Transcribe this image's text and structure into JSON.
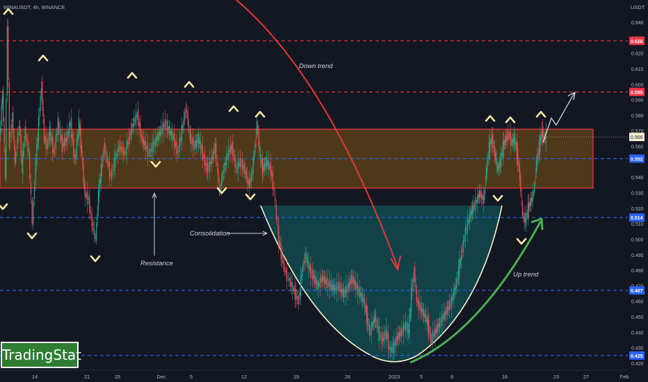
{
  "chart_data": {
    "type": "candlestick",
    "symbol_line": "MINAUSDT, 4h, BINANCE",
    "currency_label": "USDT",
    "x_tick_labels": [
      "14",
      "21",
      "25",
      "Dec",
      "5",
      "12",
      "19",
      "26",
      "2023",
      "5",
      "9",
      "16",
      "23",
      "27",
      "Feb"
    ],
    "y_range": [
      0.415,
      0.655
    ],
    "y_tick_labels": [
      "0.640",
      "0.630",
      "0.620",
      "0.610",
      "0.600",
      "0.590",
      "0.580",
      "0.570",
      "0.560",
      "0.540",
      "0.530",
      "0.520",
      "0.510",
      "0.500",
      "0.490",
      "0.480",
      "0.470",
      "0.460",
      "0.450",
      "0.440",
      "0.430",
      "0.420"
    ],
    "price_levels": [
      {
        "value": "0.628",
        "style": "red-dashed",
        "tag_color": "#f23645"
      },
      {
        "value": "0.595",
        "style": "red-dashed",
        "tag_color": "#f23645"
      },
      {
        "value": "0.552",
        "style": "blue-dashed",
        "tag_color": "#2962ff"
      },
      {
        "value": "0.514",
        "style": "blue-dashed",
        "tag_color": "#2962ff"
      },
      {
        "value": "0.467",
        "style": "blue-dashed",
        "tag_color": "#2962ff"
      },
      {
        "value": "0.425",
        "style": "blue-dashed",
        "tag_color": "#2962ff"
      }
    ],
    "last_price": "0.566",
    "resistance_zone": [
      0.533,
      0.571
    ],
    "annotations": [
      "Down trend",
      "Consolidation",
      "Resistance",
      "Up trend"
    ],
    "colors": {
      "up": "#26a69a",
      "down": "#ef5350",
      "zone_fill": "#5d4218",
      "zone_border": "#f23645",
      "cup_fill": "#124a4d",
      "cup_line": "#fff7d1",
      "marker": "#f5e6a3",
      "downtrend_arrow": "#e53935",
      "uptrend_arrow": "#4caf50"
    },
    "series": [
      {
        "name": "path",
        "points": [
          [
            0,
            0.565
          ],
          [
            4,
            0.595
          ],
          [
            8,
            0.54
          ],
          [
            11,
            0.64
          ],
          [
            14,
            0.56
          ],
          [
            18,
            0.58
          ],
          [
            22,
            0.55
          ],
          [
            28,
            0.575
          ],
          [
            32,
            0.545
          ],
          [
            36,
            0.57
          ],
          [
            42,
            0.555
          ],
          [
            47,
            0.51
          ],
          [
            52,
            0.55
          ],
          [
            56,
            0.575
          ],
          [
            60,
            0.6
          ],
          [
            64,
            0.565
          ],
          [
            68,
            0.56
          ],
          [
            72,
            0.57
          ],
          [
            78,
            0.555
          ],
          [
            84,
            0.575
          ],
          [
            90,
            0.56
          ],
          [
            96,
            0.565
          ],
          [
            102,
            0.575
          ],
          [
            108,
            0.55
          ],
          [
            114,
            0.575
          ],
          [
            118,
            0.555
          ],
          [
            122,
            0.53
          ],
          [
            128,
            0.525
          ],
          [
            133,
            0.51
          ],
          [
            138,
            0.5
          ],
          [
            142,
            0.53
          ],
          [
            146,
            0.545
          ],
          [
            150,
            0.56
          ],
          [
            155,
            0.55
          ],
          [
            160,
            0.54
          ],
          [
            165,
            0.55
          ],
          [
            172,
            0.56
          ],
          [
            180,
            0.555
          ],
          [
            186,
            0.565
          ],
          [
            192,
            0.575
          ],
          [
            198,
            0.58
          ],
          [
            204,
            0.565
          ],
          [
            210,
            0.56
          ],
          [
            215,
            0.555
          ],
          [
            220,
            0.56
          ],
          [
            226,
            0.565
          ],
          [
            232,
            0.57
          ],
          [
            238,
            0.575
          ],
          [
            244,
            0.57
          ],
          [
            250,
            0.565
          ],
          [
            256,
            0.555
          ],
          [
            262,
            0.57
          ],
          [
            268,
            0.585
          ],
          [
            274,
            0.565
          ],
          [
            280,
            0.56
          ],
          [
            286,
            0.565
          ],
          [
            292,
            0.555
          ],
          [
            298,
            0.545
          ],
          [
            304,
            0.55
          ],
          [
            310,
            0.56
          ],
          [
            316,
            0.53
          ],
          [
            322,
            0.545
          ],
          [
            328,
            0.555
          ],
          [
            334,
            0.56
          ],
          [
            340,
            0.545
          ],
          [
            346,
            0.55
          ],
          [
            352,
            0.545
          ],
          [
            358,
            0.535
          ],
          [
            362,
            0.54
          ],
          [
            366,
            0.555
          ],
          [
            370,
            0.575
          ],
          [
            374,
            0.555
          ],
          [
            378,
            0.545
          ],
          [
            384,
            0.55
          ],
          [
            390,
            0.545
          ],
          [
            395,
            0.53
          ],
          [
            400,
            0.505
          ],
          [
            405,
            0.49
          ],
          [
            410,
            0.48
          ],
          [
            415,
            0.475
          ],
          [
            420,
            0.47
          ],
          [
            425,
            0.465
          ],
          [
            430,
            0.46
          ],
          [
            435,
            0.48
          ],
          [
            440,
            0.49
          ],
          [
            446,
            0.48
          ],
          [
            452,
            0.475
          ],
          [
            458,
            0.47
          ],
          [
            464,
            0.475
          ],
          [
            470,
            0.472
          ],
          [
            476,
            0.47
          ],
          [
            482,
            0.468
          ],
          [
            488,
            0.47
          ],
          [
            494,
            0.465
          ],
          [
            500,
            0.468
          ],
          [
            506,
            0.475
          ],
          [
            512,
            0.47
          ],
          [
            518,
            0.465
          ],
          [
            524,
            0.46
          ],
          [
            528,
            0.45
          ],
          [
            532,
            0.44
          ],
          [
            536,
            0.445
          ],
          [
            540,
            0.45
          ],
          [
            545,
            0.44
          ],
          [
            550,
            0.435
          ],
          [
            556,
            0.44
          ],
          [
            561,
            0.428
          ],
          [
            566,
            0.43
          ],
          [
            572,
            0.437
          ],
          [
            578,
            0.44
          ],
          [
            584,
            0.445
          ],
          [
            588,
            0.44
          ],
          [
            592,
            0.465
          ],
          [
            596,
            0.48
          ],
          [
            600,
            0.46
          ],
          [
            606,
            0.455
          ],
          [
            612,
            0.45
          ],
          [
            616,
            0.445
          ],
          [
            620,
            0.435
          ],
          [
            626,
            0.44
          ],
          [
            632,
            0.445
          ],
          [
            638,
            0.45
          ],
          [
            644,
            0.455
          ],
          [
            650,
            0.46
          ],
          [
            656,
            0.47
          ],
          [
            660,
            0.48
          ],
          [
            664,
            0.49
          ],
          [
            670,
            0.505
          ],
          [
            676,
            0.515
          ],
          [
            680,
            0.52
          ],
          [
            686,
            0.525
          ],
          [
            690,
            0.53
          ],
          [
            696,
            0.525
          ],
          [
            700,
            0.545
          ],
          [
            704,
            0.56
          ],
          [
            708,
            0.565
          ],
          [
            712,
            0.555
          ],
          [
            716,
            0.545
          ],
          [
            720,
            0.55
          ],
          [
            724,
            0.56
          ],
          [
            728,
            0.565
          ],
          [
            732,
            0.568
          ],
          [
            736,
            0.562
          ],
          [
            740,
            0.565
          ],
          [
            744,
            0.556
          ],
          [
            748,
            0.54
          ],
          [
            752,
            0.515
          ],
          [
            756,
            0.512
          ],
          [
            760,
            0.52
          ],
          [
            764,
            0.525
          ],
          [
            768,
            0.53
          ],
          [
            772,
            0.55
          ],
          [
            776,
            0.56
          ],
          [
            780,
            0.57
          ],
          [
            783,
            0.565
          ],
          [
            786,
            0.566
          ]
        ]
      }
    ]
  },
  "branding": {
    "text": "TradingStat"
  }
}
